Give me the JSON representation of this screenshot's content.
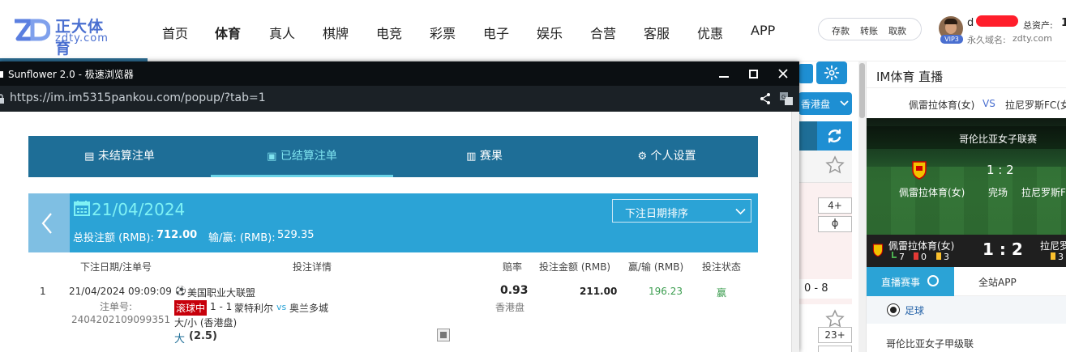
{
  "header": {
    "logo_cn": "正大体育",
    "logo_en": "zdty.com",
    "logo_mark": "ZD",
    "nav": [
      "首页",
      "体育",
      "真人",
      "棋牌",
      "电竞",
      "彩票",
      "电子",
      "娱乐",
      "合营",
      "客服",
      "优惠",
      "APP"
    ],
    "active_nav_index": 1,
    "wallet": {
      "deposit": "存款",
      "transfer": "转账",
      "withdraw": "取款"
    },
    "vip_badge": "VIP3",
    "username": "d",
    "balance_label": "总资产:",
    "balance_value": "1",
    "domain_label": "永久域名:",
    "domain_value": "zdty.com"
  },
  "popup": {
    "window_title": "Sunflower 2.0 - 极速浏览器",
    "url": "https://im.im5315pankou.com/popup/?tab=1",
    "tabs": [
      {
        "label": "未结算注单",
        "icon": "unsettled-bets-icon"
      },
      {
        "label": "已结算注单",
        "icon": "settled-bets-icon"
      },
      {
        "label": "赛果",
        "icon": "results-icon"
      },
      {
        "label": "个人设置",
        "icon": "settings-gear-icon"
      }
    ],
    "active_tab_index": 1,
    "date": "21/04/2024",
    "sort_label": "下注日期排序",
    "summary": {
      "stake_label": "总投注额 (RMB):",
      "stake_value": "712.00",
      "winloss_label": "输/赢: (RMB):",
      "winloss_value": "529.35"
    },
    "columns": {
      "date": "下注日期/注单号",
      "detail": "投注详情",
      "odds": "赔率",
      "stake": "投注金额 (RMB)",
      "winloss": "赢/输 (RMB)",
      "status": "投注状态"
    },
    "bets": [
      {
        "index": "1",
        "datetime": "21/04/2024 09:09:09",
        "bet_no_label": "注单号:",
        "bet_no": "2404202109099351",
        "league": "美国职业大联盟",
        "live_tag": "滚球中",
        "score": "1 - 1",
        "home": "蒙特利尔",
        "vs": "vs",
        "away": "奥兰多城",
        "market": "大/小 (香港盘)",
        "selection": "大",
        "line": "(2.5)",
        "odds": "0.93",
        "odds_type": "香港盘",
        "stake": "211.00",
        "winloss": "196.23",
        "status": "赢"
      }
    ]
  },
  "background": {
    "odds_type": "香港盘",
    "more_markets_1": "4+",
    "handicap_score": "0 - 8",
    "more_markets_2": "23+",
    "live_title": "IM体育 直播",
    "match_home": "佩雷拉体育(女)",
    "match_vs": "VS",
    "match_away": "拉尼罗斯FC(女)",
    "league_name": "哥伦比亚女子联赛",
    "score": "1 : 2",
    "status": "完场",
    "home_short": "佩雷拉体育(女)",
    "away_short": "拉尼罗斯F",
    "bar_home": "佩雷拉体育(女)",
    "bar_score": "1 : 2",
    "bar_away": "拉尼罗",
    "bar_corners": "7",
    "bar_red": "0",
    "bar_yellow": "3",
    "bar_yellow_away": "3",
    "tab_live": "直播赛事",
    "tab_app": "全站APP",
    "sport": "足球",
    "league_row": "哥伦比亚女子甲级联"
  },
  "colors": {
    "tab_bar": "#1e6e97",
    "date_box": "#2ba3d6",
    "active_tab": "#7fe3ef",
    "live_tag": "#c7000b",
    "win": "#3a9c4e",
    "brand": "#4a6fd0",
    "odds_btn": "#1e8fd3"
  }
}
